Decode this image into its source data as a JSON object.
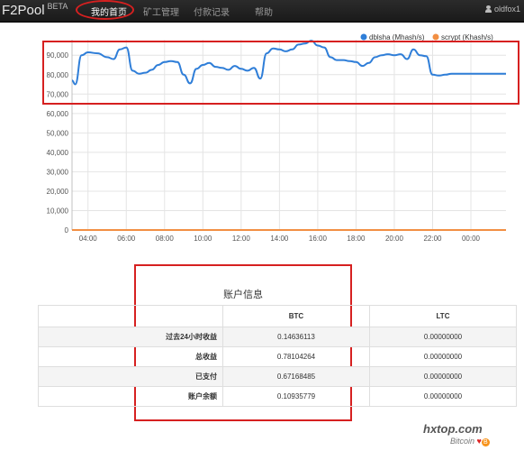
{
  "navbar": {
    "brand": "F2Pool",
    "beta": "BETA",
    "items": [
      {
        "label": "我的首页",
        "active": true
      },
      {
        "label": "矿工管理",
        "active": false
      },
      {
        "label": "付款记录",
        "active": false
      },
      {
        "label": "帮助",
        "active": false
      }
    ],
    "user": "oldfox1"
  },
  "chart_data": {
    "type": "line",
    "x_ticks": [
      "04:00",
      "06:00",
      "08:00",
      "10:00",
      "12:00",
      "14:00",
      "16:00",
      "18:00",
      "20:00",
      "22:00",
      "00:00"
    ],
    "y_ticks": [
      "0",
      "10,000",
      "20,000",
      "30,000",
      "40,000",
      "50,000",
      "60,000",
      "70,000",
      "80,000",
      "90,000"
    ],
    "ylim": [
      0,
      98000
    ],
    "x_range": [
      "03:10",
      "01:50"
    ],
    "grid": true,
    "legend_position": "top-right",
    "series": [
      {
        "name": "dblsha (Mhash/s)",
        "color": "#2f7ed8",
        "x": [
          "03:10",
          "03:20",
          "03:40",
          "04:00",
          "04:30",
          "05:00",
          "05:20",
          "05:40",
          "06:00",
          "06:20",
          "06:40",
          "07:00",
          "07:20",
          "07:40",
          "08:00",
          "08:20",
          "08:40",
          "09:00",
          "09:20",
          "09:40",
          "10:00",
          "10:20",
          "10:40",
          "11:00",
          "11:20",
          "11:40",
          "12:00",
          "12:20",
          "12:40",
          "13:00",
          "13:20",
          "13:40",
          "14:00",
          "14:20",
          "14:40",
          "15:00",
          "15:20",
          "15:40",
          "16:00",
          "16:20",
          "16:40",
          "17:00",
          "17:20",
          "17:40",
          "18:00",
          "18:20",
          "18:40",
          "19:00",
          "19:20",
          "19:40",
          "20:00",
          "20:20",
          "20:40",
          "21:00",
          "21:20",
          "21:40",
          "22:00",
          "22:20",
          "22:40",
          "23:00",
          "23:20",
          "23:40",
          "00:00",
          "00:20",
          "00:40",
          "01:00",
          "01:20",
          "01:50"
        ],
        "values": [
          77000,
          75000,
          90000,
          91500,
          91000,
          89000,
          88000,
          93000,
          94000,
          82000,
          80500,
          81000,
          82500,
          85000,
          86500,
          87000,
          86500,
          80000,
          75500,
          83000,
          85000,
          86000,
          84000,
          83500,
          82500,
          84500,
          83000,
          82000,
          83500,
          78000,
          91000,
          93500,
          93000,
          92000,
          93000,
          95500,
          96000,
          97500,
          95000,
          94000,
          89000,
          87500,
          87500,
          87000,
          86500,
          84500,
          86000,
          89000,
          90000,
          90500,
          90000,
          90500,
          88000,
          93000,
          90000,
          89500,
          80000,
          79500,
          80000,
          80500,
          80500,
          80500,
          80500,
          80500,
          80500,
          80500,
          80500,
          80500
        ]
      },
      {
        "name": "scrypt (Khash/s)",
        "color": "#f28f43",
        "x": [
          "03:10",
          "01:50"
        ],
        "values": [
          0,
          0
        ]
      }
    ]
  },
  "account": {
    "title": "账户信息",
    "columns": [
      "",
      "BTC",
      "LTC"
    ],
    "rows": [
      {
        "label": "过去24小时收益",
        "btc": "0.14636113",
        "ltc": "0.00000000"
      },
      {
        "label": "总收益",
        "btc": "0.78104264",
        "ltc": "0.00000000"
      },
      {
        "label": "已支付",
        "btc": "0.67168485",
        "ltc": "0.00000000"
      },
      {
        "label": "账户余额",
        "btc": "0.10935779",
        "ltc": "0.00000000"
      }
    ]
  },
  "watermark": {
    "line1": "hxtop.com",
    "line2": "Bitcoin"
  }
}
